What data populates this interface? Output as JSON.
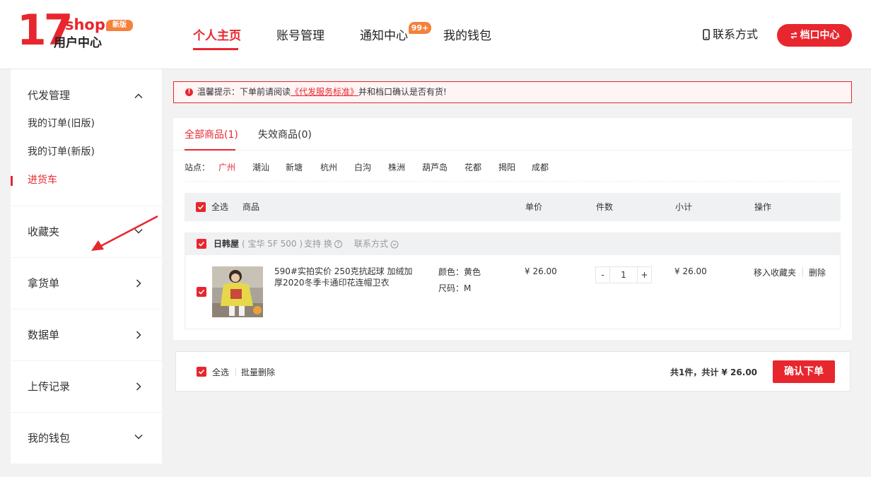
{
  "logo": {
    "mark": "17",
    "shop": ".shop",
    "badge": "新版",
    "subtitle": "用户中心"
  },
  "nav": {
    "items": [
      {
        "label": "个人主页",
        "active": true
      },
      {
        "label": "账号管理"
      },
      {
        "label": "通知中心"
      },
      {
        "label": "我的钱包"
      }
    ],
    "notice_badge": "99+",
    "contact_label": "联系方式",
    "stall_button": "档口中心"
  },
  "sidebar": {
    "groups": [
      {
        "title": "代发管理",
        "expanded": true,
        "items": [
          {
            "label": "我的订单(旧版)"
          },
          {
            "label": "我的订单(新版)"
          },
          {
            "label": "进货车",
            "active": true
          }
        ]
      },
      {
        "title": "收藏夹"
      },
      {
        "title": "拿货单"
      },
      {
        "title": "数据单"
      },
      {
        "title": "上传记录"
      },
      {
        "title": "我的钱包"
      }
    ]
  },
  "notice": {
    "prefix": "温馨提示：下单前请阅读",
    "link": "《代发服务标准》",
    "suffix": "并和档口确认是否有货!"
  },
  "tabs": [
    {
      "label": "全部商品(1)",
      "active": true
    },
    {
      "label": "失效商品(0)"
    }
  ],
  "stations": {
    "label": "站点：",
    "items": [
      "广州",
      "潮汕",
      "新塘",
      "杭州",
      "白沟",
      "株洲",
      "葫芦岛",
      "花都",
      "揭阳",
      "成都"
    ],
    "active": "广州"
  },
  "table_header": {
    "select_all": "全选",
    "product": "商品",
    "unit_price": "单价",
    "quantity": "件数",
    "subtotal": "小计",
    "actions": "操作"
  },
  "shop": {
    "name": "日韩屋",
    "location": "( 宝华 5F 500 )",
    "support": "支持 换",
    "contact": "联系方式"
  },
  "item": {
    "title": "590#实拍实价 250克抗起球 加绒加厚2020冬季卡通印花连帽卫衣",
    "color": "颜色：黄色",
    "size": "尺码：M",
    "price": "¥ 26.00",
    "quantity": "1",
    "subtotal": "¥ 26.00",
    "move_to_favorites": "移入收藏夹",
    "delete": "删除"
  },
  "footer": {
    "select_all": "全选",
    "batch_delete": "批量删除",
    "total": "共1件，共计 ¥ 26.00",
    "confirm": "确认下单"
  },
  "colors": {
    "accent": "#e8262e",
    "badge": "#f5813d"
  },
  "icons": [
    "phone-icon",
    "swap-icon",
    "chevron-up-icon",
    "chevron-down-icon",
    "chevron-right-icon",
    "info-icon",
    "check-icon",
    "help-icon",
    "circle-chevron-icon"
  ]
}
